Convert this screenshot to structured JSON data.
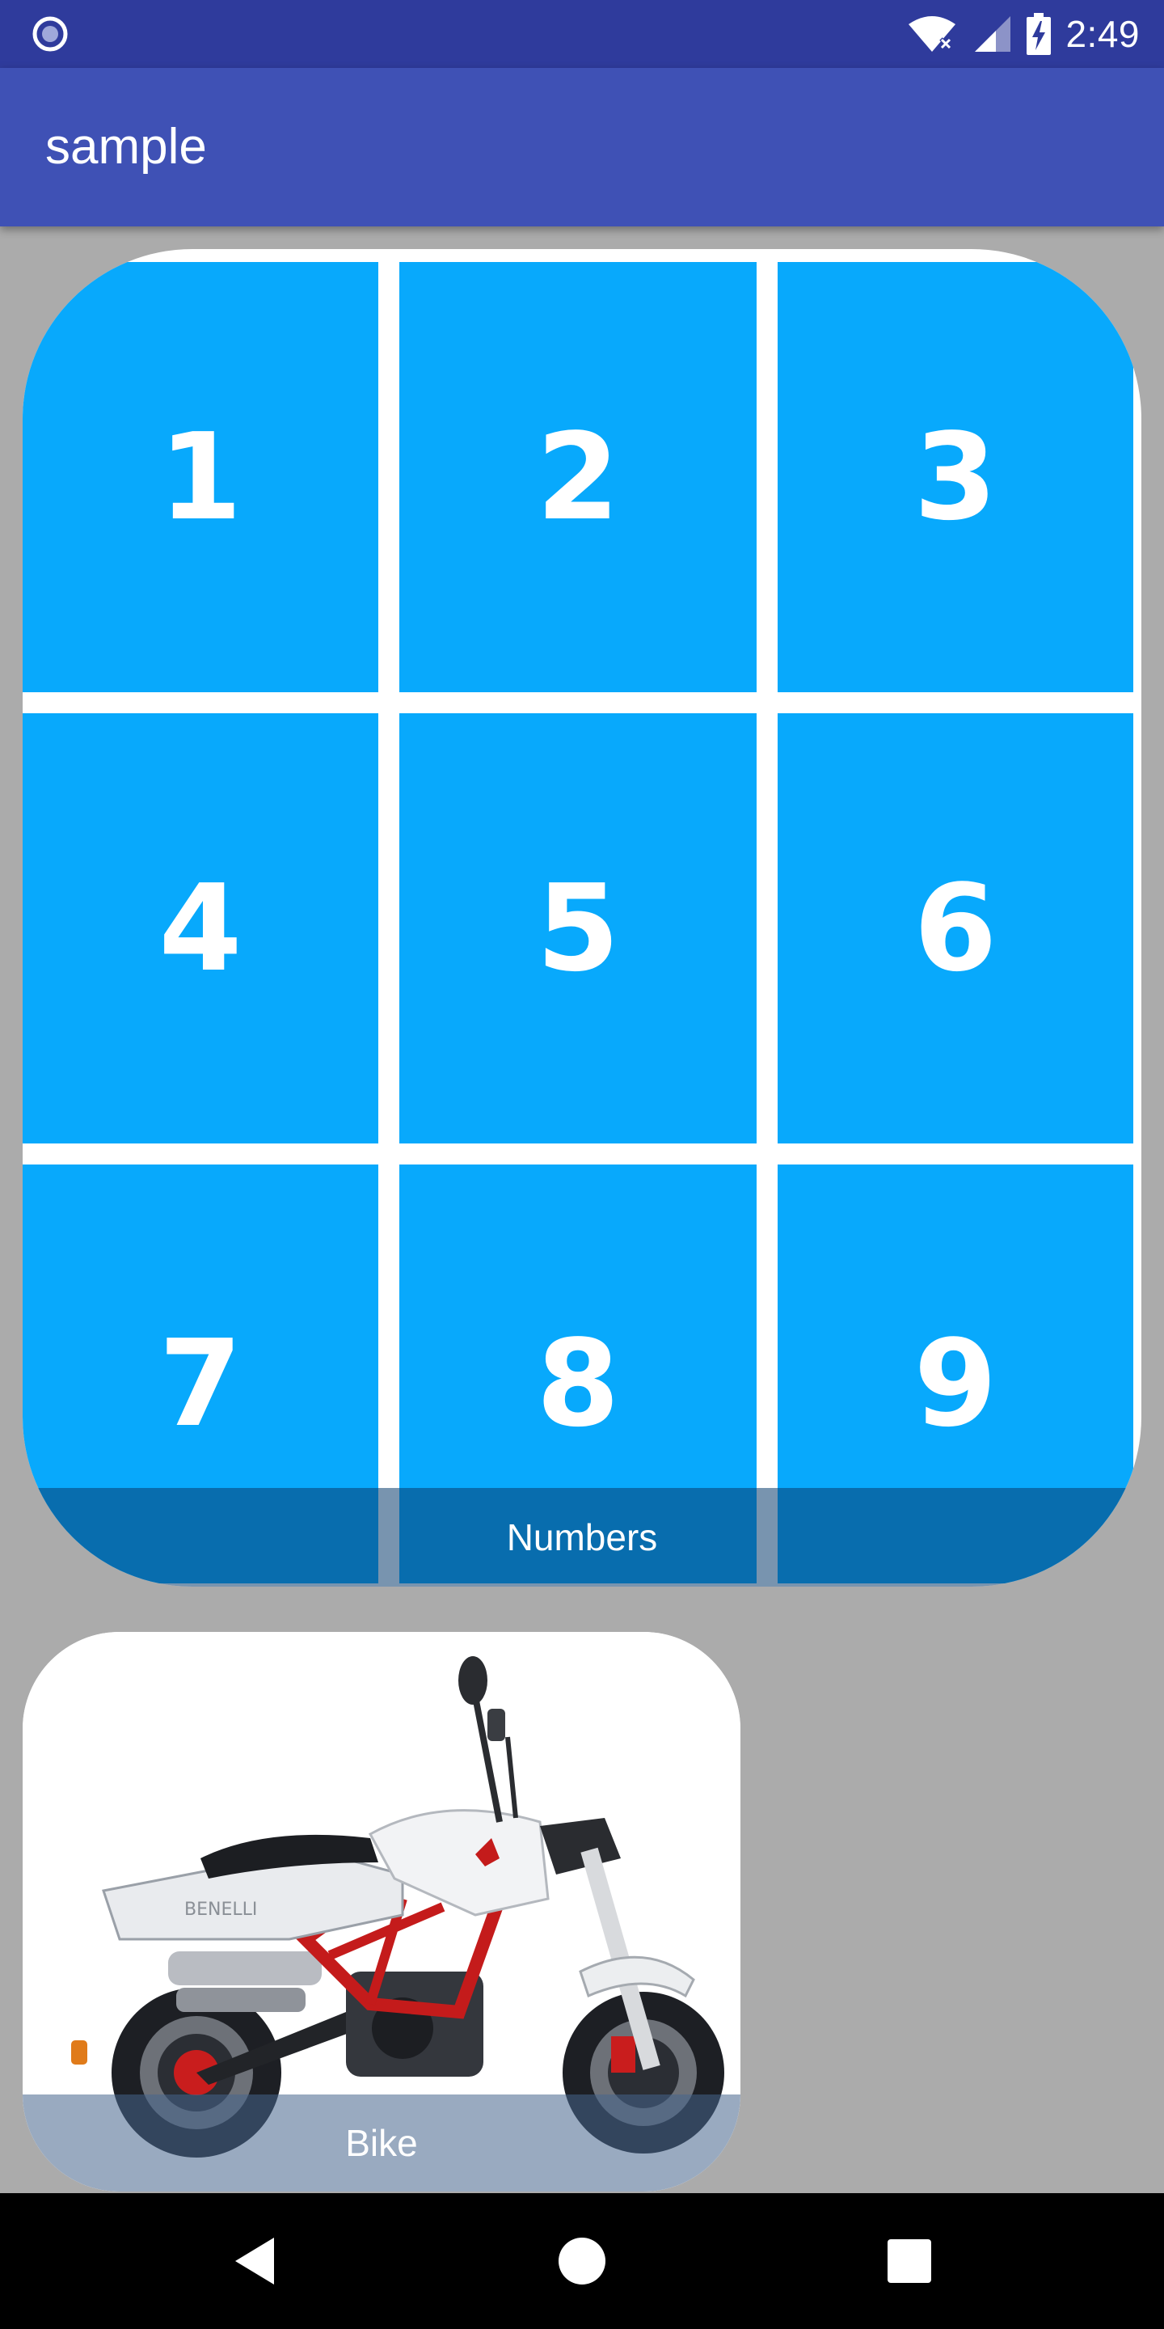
{
  "status_bar": {
    "time": "2:49",
    "icons": [
      "app-notification-icon",
      "wifi-icon",
      "cell-signal-icon",
      "battery-charging-icon"
    ]
  },
  "app_bar": {
    "title": "sample"
  },
  "numbers_card": {
    "caption": "Numbers",
    "cells": [
      "1",
      "2",
      "3",
      "4",
      "5",
      "6",
      "7",
      "8",
      "9"
    ],
    "cell_color": "#08a9fc"
  },
  "bike_card": {
    "caption": "Bike",
    "image": "motorcycle-photo"
  },
  "nav_bar": {
    "buttons": [
      "back-icon",
      "home-icon",
      "recents-icon"
    ]
  },
  "colors": {
    "status_bar": "#2f3b9c",
    "app_bar": "#3f51b5",
    "background": "#ababab"
  }
}
